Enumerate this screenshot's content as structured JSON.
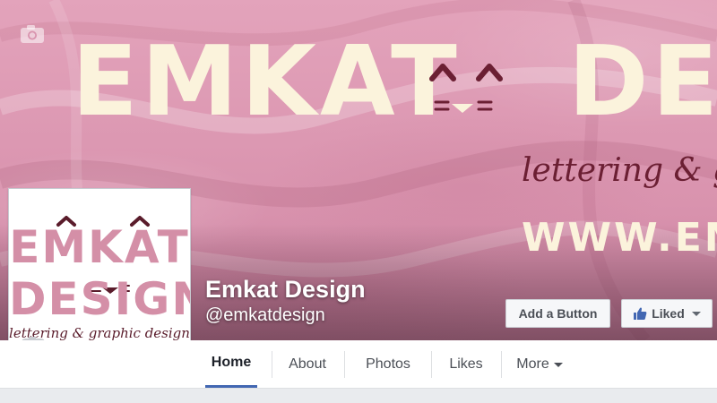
{
  "cover": {
    "title_left": "EMKAT",
    "title_right": "DESIGN",
    "tagline": "lettering & graphic design",
    "url": "WWW.EMKATDESIGN.COM",
    "camera_icon": "camera-icon"
  },
  "profile_picture": {
    "line1": "EMKAT",
    "line2": "DESIGN",
    "tagline": "lettering & graphic design",
    "camera_icon": "camera-icon"
  },
  "page": {
    "name": "Emkat Design",
    "handle": "@emkatdesign"
  },
  "actions": {
    "add_button_label": "Add a Button",
    "liked_label": "Liked",
    "liked_icon": "thumbs-up-icon"
  },
  "nav": {
    "tabs": [
      {
        "label": "Home",
        "active": true
      },
      {
        "label": "About"
      },
      {
        "label": "Photos"
      },
      {
        "label": "Likes"
      },
      {
        "label": "More"
      }
    ]
  },
  "colors": {
    "accent": "#4267b2",
    "cover_pink": "#d993ae",
    "cream": "#fbf3dc",
    "maroon": "#6b1f33"
  }
}
